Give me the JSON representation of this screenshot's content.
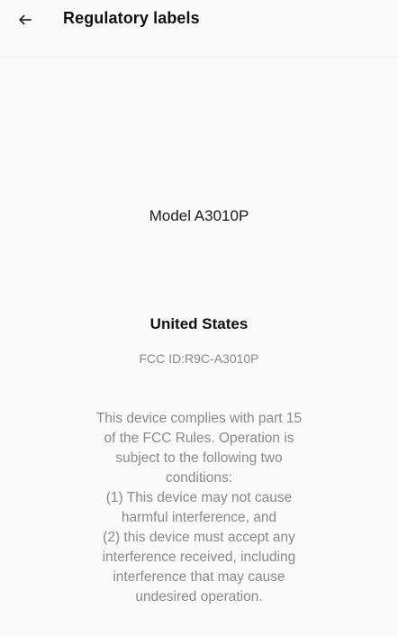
{
  "header": {
    "back_icon": "arrow-left-icon",
    "title": "Regulatory labels"
  },
  "content": {
    "model": "Model A3010P",
    "region": "United States",
    "fcc_id": "FCC ID:R9C-A3010P",
    "compliance_lines": [
      "This device complies with part 15",
      "of the FCC Rules. Operation is",
      "subject to the following two",
      "conditions:",
      "(1) This device may not cause",
      "harmful interference, and",
      "(2) this device must accept any",
      "interference received, including",
      "interference that may cause",
      "undesired operation."
    ]
  }
}
